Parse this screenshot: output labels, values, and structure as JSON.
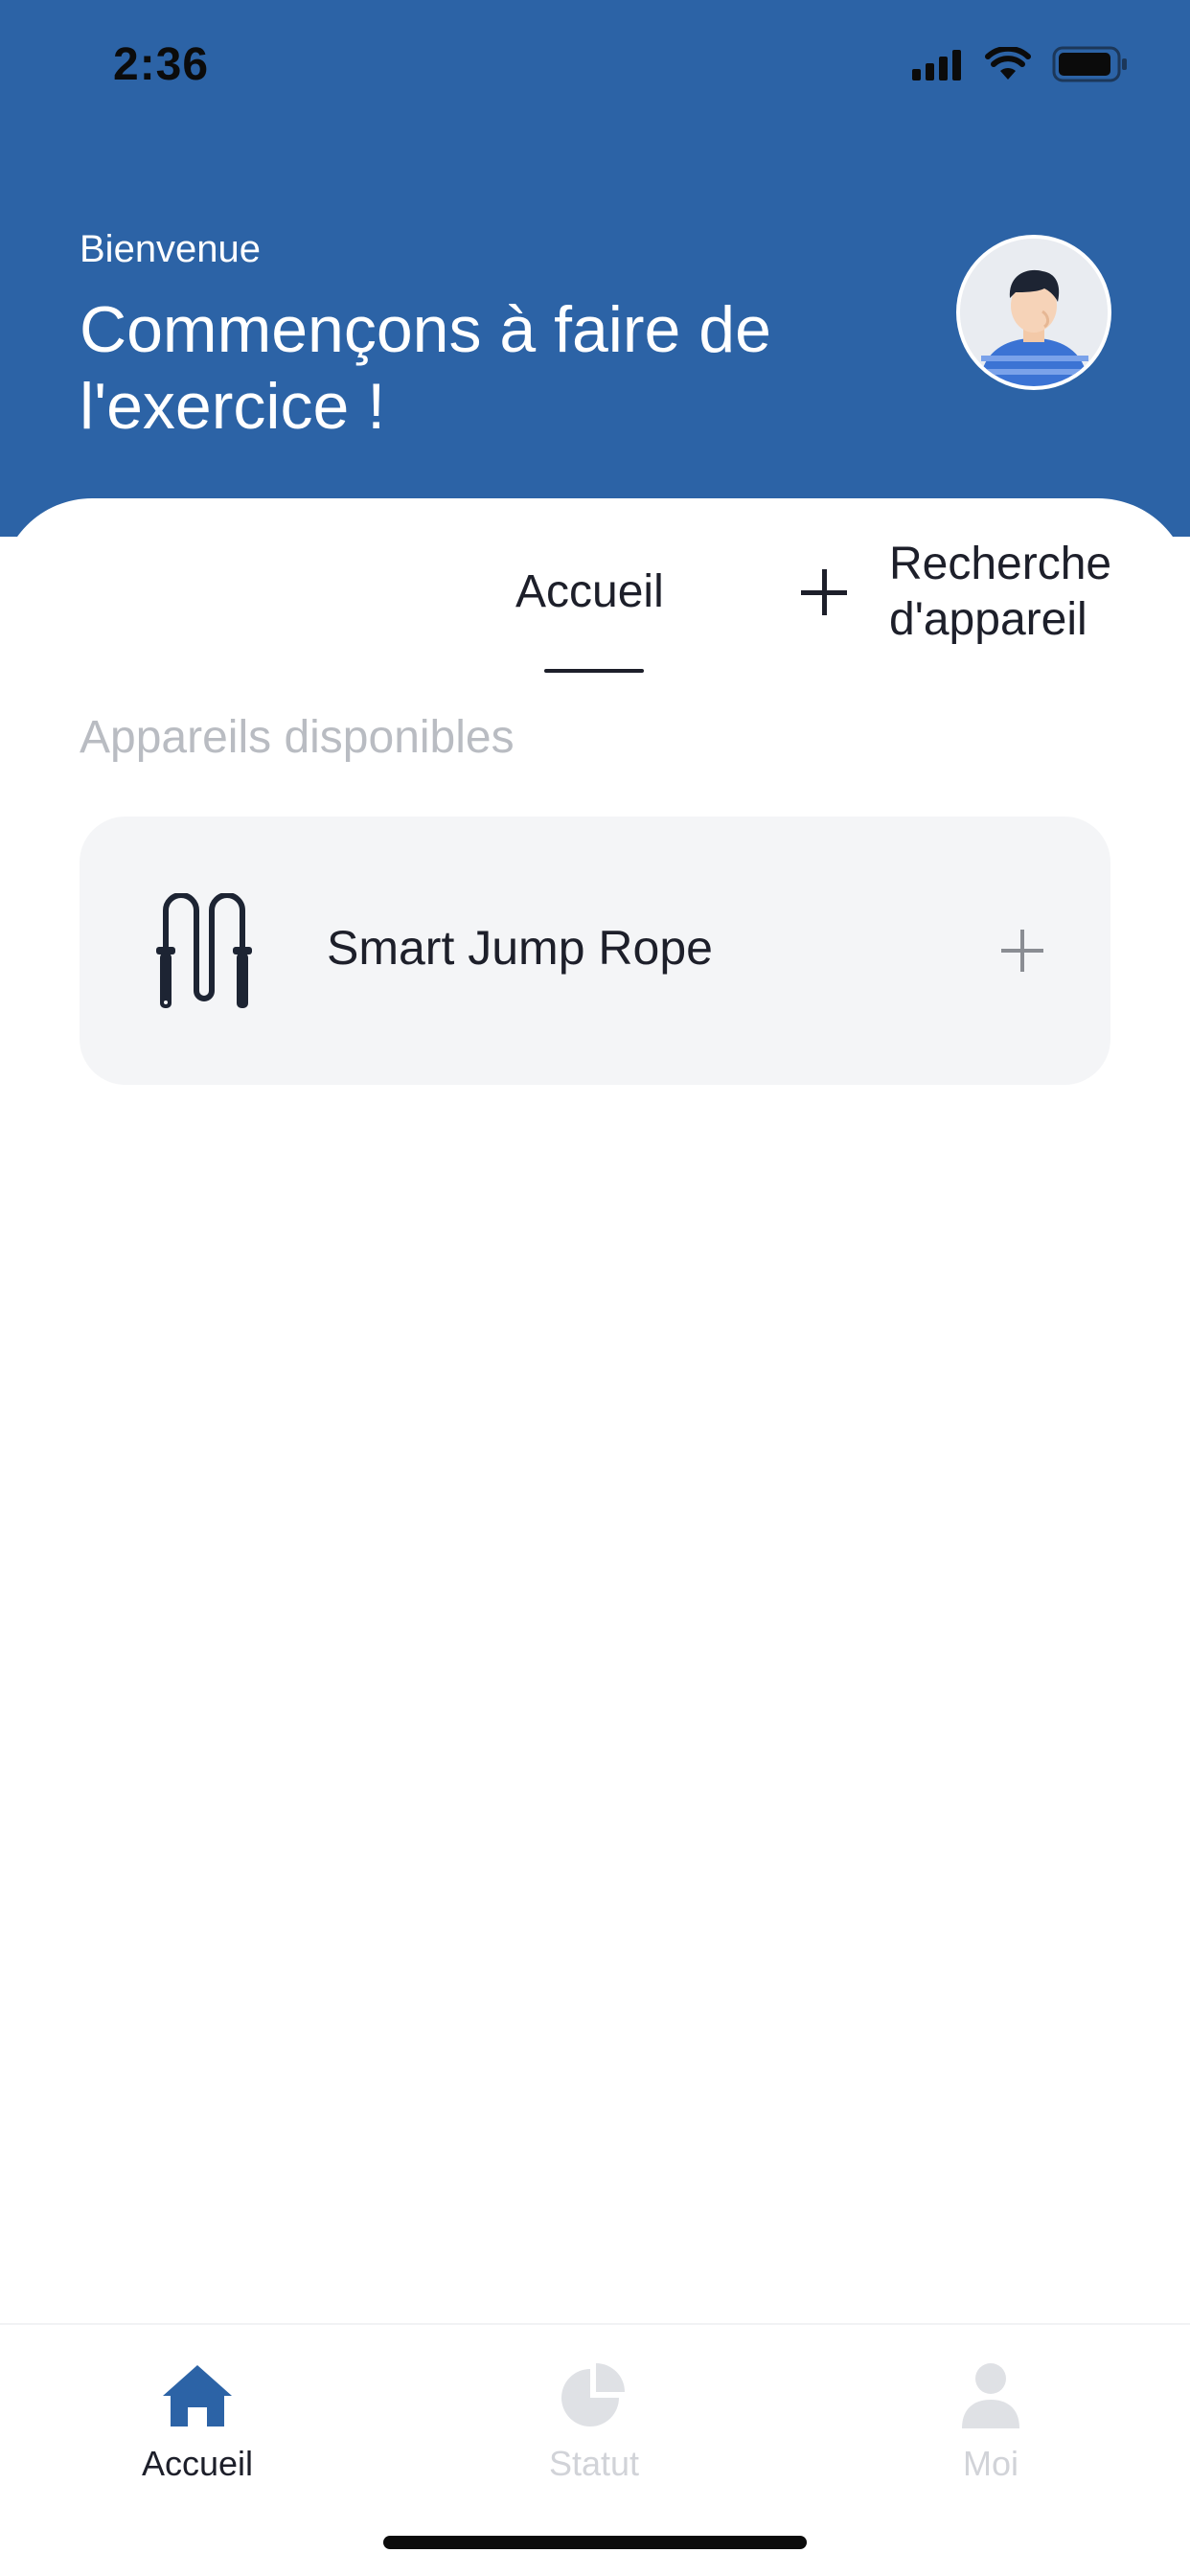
{
  "status_bar": {
    "time": "2:36",
    "icons": [
      "cellular-signal-icon",
      "wifi-icon",
      "battery-icon"
    ]
  },
  "header": {
    "welcome": "Bienvenue",
    "headline": "Commençons à faire de l'exercice !",
    "avatar_icon": "user-avatar-icon",
    "background_color": "#2c63a6"
  },
  "tabs": {
    "home_label": "Accueil",
    "search_label": "Recherche d'appareil",
    "search_icon": "plus-icon"
  },
  "devices": {
    "section_title": "Appareils disponibles",
    "items": [
      {
        "name": "Smart Jump Rope",
        "icon": "jump-rope-icon",
        "action_icon": "plus-icon"
      }
    ]
  },
  "tabbar": {
    "items": [
      {
        "label": "Accueil",
        "icon": "home-icon",
        "active": true
      },
      {
        "label": "Statut",
        "icon": "pie-chart-icon",
        "active": false
      },
      {
        "label": "Moi",
        "icon": "person-icon",
        "active": false
      }
    ],
    "active_color": "#2c63a6",
    "inactive_color": "#d1d3d8"
  }
}
